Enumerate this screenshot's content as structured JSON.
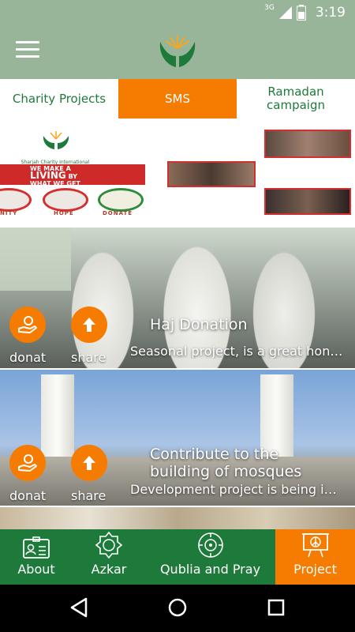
{
  "status": {
    "network": "3G",
    "time": "3:19",
    "icons": [
      "signal-icon",
      "battery-icon"
    ]
  },
  "app_bar": {
    "menu_icon": "hamburger-menu-icon",
    "logo": "sharjah-charity-hands-logo"
  },
  "tabs": [
    {
      "label": "Charity Projects",
      "active": false
    },
    {
      "label": "SMS",
      "active": true
    },
    {
      "label": "Ramadan campaign",
      "active": false
    }
  ],
  "banner": {
    "org_name": "Sharjah Charity International",
    "slogan_line1": "WE MAKE A",
    "slogan_line2": "LIVING",
    "slogan_line3": "BY",
    "slogan_line4": "WHAT WE GET",
    "captions": [
      "NITY",
      "HOPE",
      "DONATE"
    ]
  },
  "projects": [
    {
      "title": "Haj Donation",
      "description": "Seasonal project, is a great honor for the charity",
      "donate_label": "donat",
      "share_label": "share"
    },
    {
      "title": "Contribute to the building of mosques",
      "description": "Development project is being implemented",
      "donate_label": "donat",
      "share_label": "share"
    }
  ],
  "bottom_nav": [
    {
      "label": "About",
      "icon": "id-card-icon",
      "active": false
    },
    {
      "label": "Azkar",
      "icon": "ornament-icon",
      "active": false
    },
    {
      "label": "Qublia and Pray",
      "icon": "compass-icon",
      "active": false
    },
    {
      "label": "Project",
      "icon": "presentation-board-icon",
      "active": true
    }
  ],
  "colors": {
    "app_bar": "#98b59a",
    "accent": "#f57c00",
    "nav_green": "#1e7a3a"
  }
}
